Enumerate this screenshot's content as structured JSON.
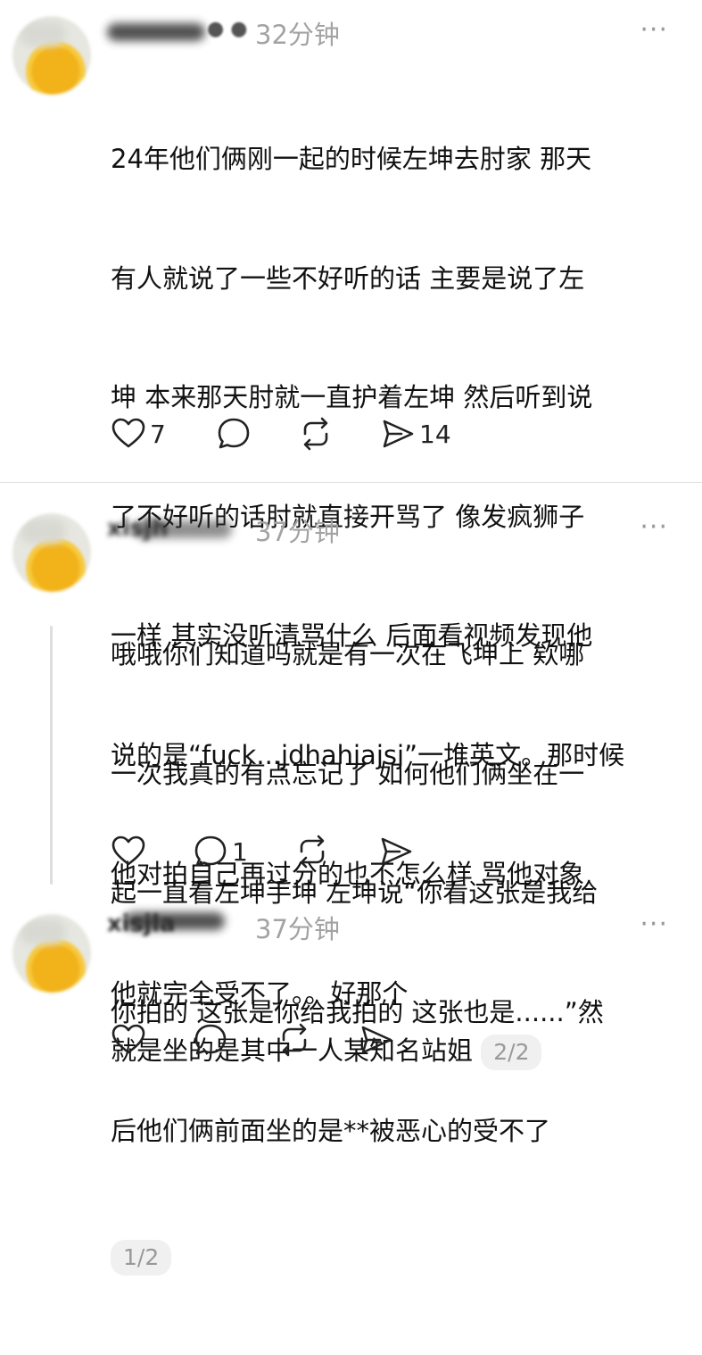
{
  "posts": [
    {
      "time": "32分钟",
      "name_fragment": "",
      "lines": [
        "24年他们俩刚一起的时候左坤去肘家 那天",
        "有人就说了一些不好听的话 主要是说了左",
        "坤 本来那天肘就一直护着左坤 然后听到说",
        "了不好听的话肘就直接开骂了 像发疯狮子",
        "一样 其实没听清骂什么 后面看视频发现他",
        "说的是“fuck...jdhahjajsj”一堆英文。那时候",
        "他对拍自己再过分的也不怎么样 骂他对象",
        "他就完全受不了。。好那个"
      ],
      "likes": "7",
      "replies": "",
      "shares": "14",
      "page": ""
    },
    {
      "time": "37分钟",
      "name_fragment": "xisjh",
      "lines": [
        "哦哦你们知道吗就是有一次在飞坤上 欸哪",
        "一次我真的有点忘记了 如何他们俩坐在一",
        "起一直看左坤手坤 左坤说“你看这张是我给",
        "你拍的 这张是你给我拍的 这张也是......”然",
        "后他们俩前面坐的是**被恶心的受不了"
      ],
      "likes": "",
      "replies": "1",
      "shares": "",
      "page": "1/2"
    },
    {
      "time": "37分钟",
      "name_fragment": "xisjla",
      "lines": [
        "就是坐的是其中一人某知名站姐"
      ],
      "likes": "",
      "replies": "",
      "shares": "",
      "page": "2/2"
    }
  ],
  "more_label": "···",
  "icons": [
    "heart-icon",
    "comment-icon",
    "repost-icon",
    "share-icon"
  ]
}
